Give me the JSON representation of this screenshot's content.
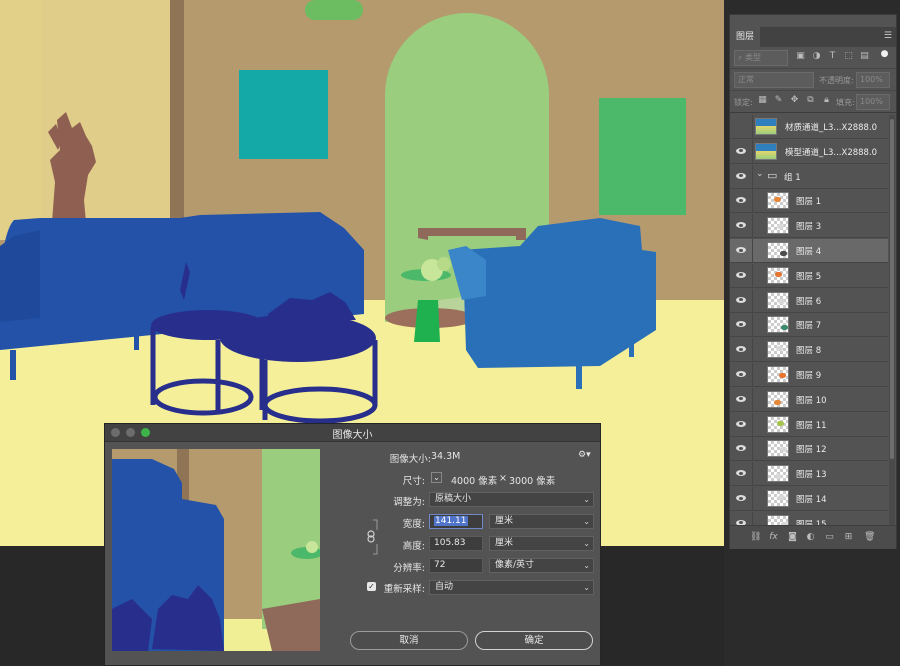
{
  "layers_panel": {
    "tab_label": "图层",
    "filter_placeholder": "类型",
    "blend_mode": "正常",
    "opacity_label": "不透明度:",
    "opacity_value": "100%",
    "lock_label": "锁定:",
    "fill_label": "填充:",
    "fill_value": "100%",
    "layers": [
      {
        "name": "材质通道_L3...X2888.0",
        "visible": false,
        "kind": "image"
      },
      {
        "name": "模型通道_L3...X2888.0",
        "visible": true,
        "kind": "image"
      },
      {
        "name": "组 1",
        "visible": true,
        "kind": "group"
      },
      {
        "name": "图层 1",
        "visible": true,
        "kind": "layer"
      },
      {
        "name": "图层 3",
        "visible": true,
        "kind": "layer"
      },
      {
        "name": "图层 4",
        "visible": true,
        "kind": "layer",
        "selected": true
      },
      {
        "name": "图层 5",
        "visible": true,
        "kind": "layer"
      },
      {
        "name": "图层 6",
        "visible": true,
        "kind": "layer"
      },
      {
        "name": "图层 7",
        "visible": true,
        "kind": "layer"
      },
      {
        "name": "图层 8",
        "visible": true,
        "kind": "layer"
      },
      {
        "name": "图层 9",
        "visible": true,
        "kind": "layer"
      },
      {
        "name": "图层 10",
        "visible": true,
        "kind": "layer"
      },
      {
        "name": "图层 11",
        "visible": true,
        "kind": "layer"
      },
      {
        "name": "图层 12",
        "visible": true,
        "kind": "layer"
      },
      {
        "name": "图层 13",
        "visible": true,
        "kind": "layer"
      },
      {
        "name": "图层 14",
        "visible": true,
        "kind": "layer"
      },
      {
        "name": "图层 15",
        "visible": true,
        "kind": "layer"
      }
    ]
  },
  "dialog": {
    "title": "图像大小",
    "image_size_label": "图像大小:",
    "image_size_value": "34.3M",
    "dimensions_label": "尺寸:",
    "dimensions_width": "4000 像素",
    "dimensions_times": "×",
    "dimensions_height": "3000 像素",
    "fit_to_label": "调整为:",
    "fit_to_value": "原稿大小",
    "width_label": "宽度:",
    "width_value": "141.11",
    "width_unit": "厘米",
    "height_label": "高度:",
    "height_value": "105.83",
    "height_unit": "厘米",
    "resolution_label": "分辨率:",
    "resolution_value": "72",
    "resolution_unit": "像素/英寸",
    "resample_label": "重新采样:",
    "resample_checked": true,
    "resample_value": "自动",
    "cancel_label": "取消",
    "ok_label": "确定"
  },
  "colors": {
    "wall": "#b59a6e",
    "floor": "#f4ef98",
    "sofa_blue": "#2352a8",
    "armchair_blue": "#2a70b8",
    "table_navy": "#272e8c",
    "arch_green": "#9acd7e",
    "teal_frame": "#14a8a6",
    "green_frame": "#4cb96a",
    "statue_brown": "#8f5f52",
    "left_wall": "#e2d089",
    "selection_blue": "#4f74c9"
  }
}
